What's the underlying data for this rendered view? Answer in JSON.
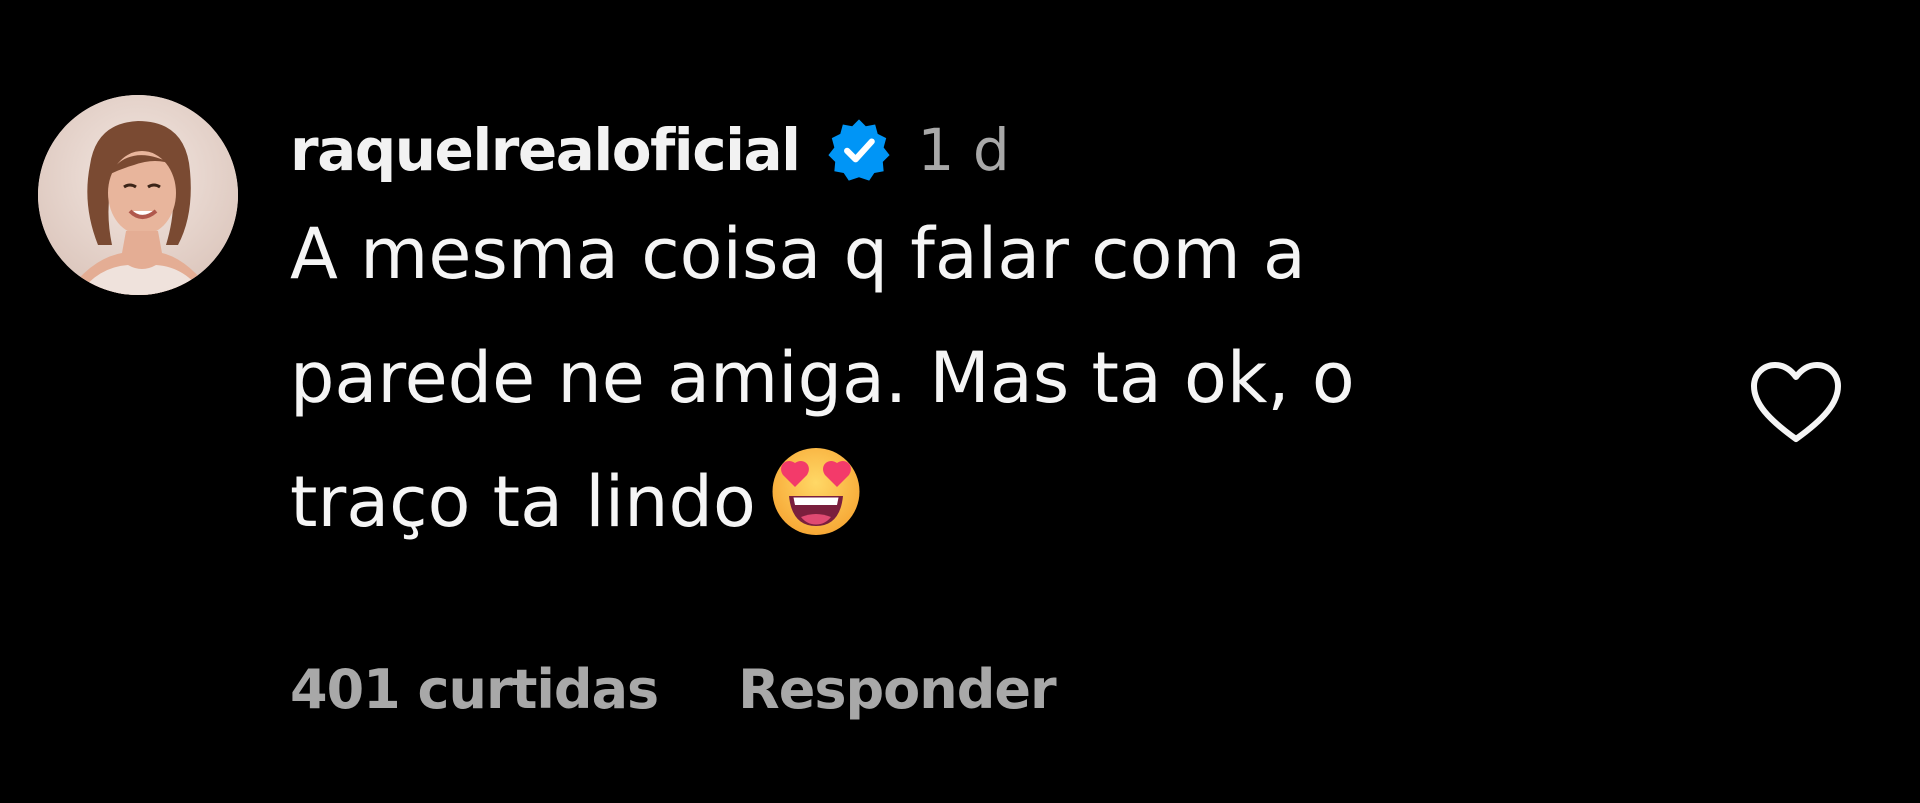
{
  "comment": {
    "username": "raquelrealoficial",
    "verified_icon": "verified-badge-icon",
    "time": "1 d",
    "text": "A mesma coisa q falar com a\nparede ne amiga. Mas ta ok, o\ntraço ta lindo",
    "emoji": "smiling-face-with-heart-eyes",
    "likes": "401 curtidas",
    "reply_label": "Responder",
    "like_icon": "heart-outline-icon"
  },
  "colors": {
    "background": "#000000",
    "text": "#f5f5f5",
    "secondary": "#a8a8a8",
    "verified": "#0095f6"
  }
}
